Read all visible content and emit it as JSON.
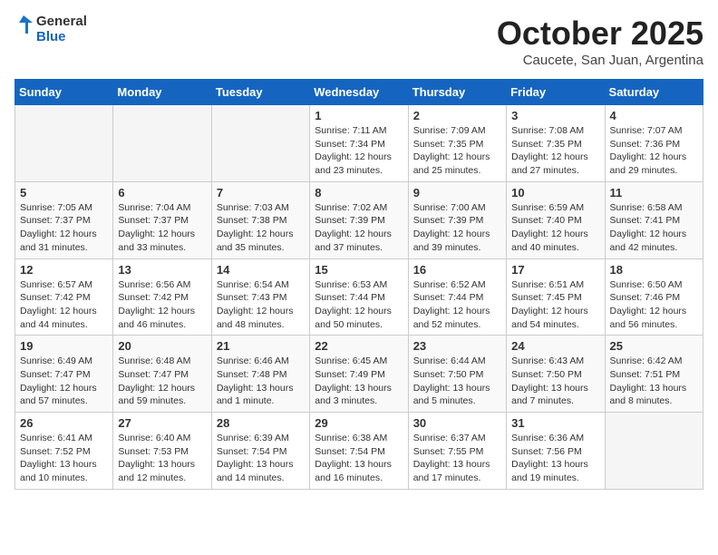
{
  "header": {
    "logo": {
      "text_general": "General",
      "text_blue": "Blue"
    },
    "title": "October 2025",
    "subtitle": "Caucete, San Juan, Argentina"
  },
  "calendar": {
    "weekdays": [
      "Sunday",
      "Monday",
      "Tuesday",
      "Wednesday",
      "Thursday",
      "Friday",
      "Saturday"
    ],
    "weeks": [
      [
        {
          "day": "",
          "info": ""
        },
        {
          "day": "",
          "info": ""
        },
        {
          "day": "",
          "info": ""
        },
        {
          "day": "1",
          "info": "Sunrise: 7:11 AM\nSunset: 7:34 PM\nDaylight: 12 hours\nand 23 minutes."
        },
        {
          "day": "2",
          "info": "Sunrise: 7:09 AM\nSunset: 7:35 PM\nDaylight: 12 hours\nand 25 minutes."
        },
        {
          "day": "3",
          "info": "Sunrise: 7:08 AM\nSunset: 7:35 PM\nDaylight: 12 hours\nand 27 minutes."
        },
        {
          "day": "4",
          "info": "Sunrise: 7:07 AM\nSunset: 7:36 PM\nDaylight: 12 hours\nand 29 minutes."
        }
      ],
      [
        {
          "day": "5",
          "info": "Sunrise: 7:05 AM\nSunset: 7:37 PM\nDaylight: 12 hours\nand 31 minutes."
        },
        {
          "day": "6",
          "info": "Sunrise: 7:04 AM\nSunset: 7:37 PM\nDaylight: 12 hours\nand 33 minutes."
        },
        {
          "day": "7",
          "info": "Sunrise: 7:03 AM\nSunset: 7:38 PM\nDaylight: 12 hours\nand 35 minutes."
        },
        {
          "day": "8",
          "info": "Sunrise: 7:02 AM\nSunset: 7:39 PM\nDaylight: 12 hours\nand 37 minutes."
        },
        {
          "day": "9",
          "info": "Sunrise: 7:00 AM\nSunset: 7:39 PM\nDaylight: 12 hours\nand 39 minutes."
        },
        {
          "day": "10",
          "info": "Sunrise: 6:59 AM\nSunset: 7:40 PM\nDaylight: 12 hours\nand 40 minutes."
        },
        {
          "day": "11",
          "info": "Sunrise: 6:58 AM\nSunset: 7:41 PM\nDaylight: 12 hours\nand 42 minutes."
        }
      ],
      [
        {
          "day": "12",
          "info": "Sunrise: 6:57 AM\nSunset: 7:42 PM\nDaylight: 12 hours\nand 44 minutes."
        },
        {
          "day": "13",
          "info": "Sunrise: 6:56 AM\nSunset: 7:42 PM\nDaylight: 12 hours\nand 46 minutes."
        },
        {
          "day": "14",
          "info": "Sunrise: 6:54 AM\nSunset: 7:43 PM\nDaylight: 12 hours\nand 48 minutes."
        },
        {
          "day": "15",
          "info": "Sunrise: 6:53 AM\nSunset: 7:44 PM\nDaylight: 12 hours\nand 50 minutes."
        },
        {
          "day": "16",
          "info": "Sunrise: 6:52 AM\nSunset: 7:44 PM\nDaylight: 12 hours\nand 52 minutes."
        },
        {
          "day": "17",
          "info": "Sunrise: 6:51 AM\nSunset: 7:45 PM\nDaylight: 12 hours\nand 54 minutes."
        },
        {
          "day": "18",
          "info": "Sunrise: 6:50 AM\nSunset: 7:46 PM\nDaylight: 12 hours\nand 56 minutes."
        }
      ],
      [
        {
          "day": "19",
          "info": "Sunrise: 6:49 AM\nSunset: 7:47 PM\nDaylight: 12 hours\nand 57 minutes."
        },
        {
          "day": "20",
          "info": "Sunrise: 6:48 AM\nSunset: 7:47 PM\nDaylight: 12 hours\nand 59 minutes."
        },
        {
          "day": "21",
          "info": "Sunrise: 6:46 AM\nSunset: 7:48 PM\nDaylight: 13 hours\nand 1 minute."
        },
        {
          "day": "22",
          "info": "Sunrise: 6:45 AM\nSunset: 7:49 PM\nDaylight: 13 hours\nand 3 minutes."
        },
        {
          "day": "23",
          "info": "Sunrise: 6:44 AM\nSunset: 7:50 PM\nDaylight: 13 hours\nand 5 minutes."
        },
        {
          "day": "24",
          "info": "Sunrise: 6:43 AM\nSunset: 7:50 PM\nDaylight: 13 hours\nand 7 minutes."
        },
        {
          "day": "25",
          "info": "Sunrise: 6:42 AM\nSunset: 7:51 PM\nDaylight: 13 hours\nand 8 minutes."
        }
      ],
      [
        {
          "day": "26",
          "info": "Sunrise: 6:41 AM\nSunset: 7:52 PM\nDaylight: 13 hours\nand 10 minutes."
        },
        {
          "day": "27",
          "info": "Sunrise: 6:40 AM\nSunset: 7:53 PM\nDaylight: 13 hours\nand 12 minutes."
        },
        {
          "day": "28",
          "info": "Sunrise: 6:39 AM\nSunset: 7:54 PM\nDaylight: 13 hours\nand 14 minutes."
        },
        {
          "day": "29",
          "info": "Sunrise: 6:38 AM\nSunset: 7:54 PM\nDaylight: 13 hours\nand 16 minutes."
        },
        {
          "day": "30",
          "info": "Sunrise: 6:37 AM\nSunset: 7:55 PM\nDaylight: 13 hours\nand 17 minutes."
        },
        {
          "day": "31",
          "info": "Sunrise: 6:36 AM\nSunset: 7:56 PM\nDaylight: 13 hours\nand 19 minutes."
        },
        {
          "day": "",
          "info": ""
        }
      ]
    ]
  }
}
